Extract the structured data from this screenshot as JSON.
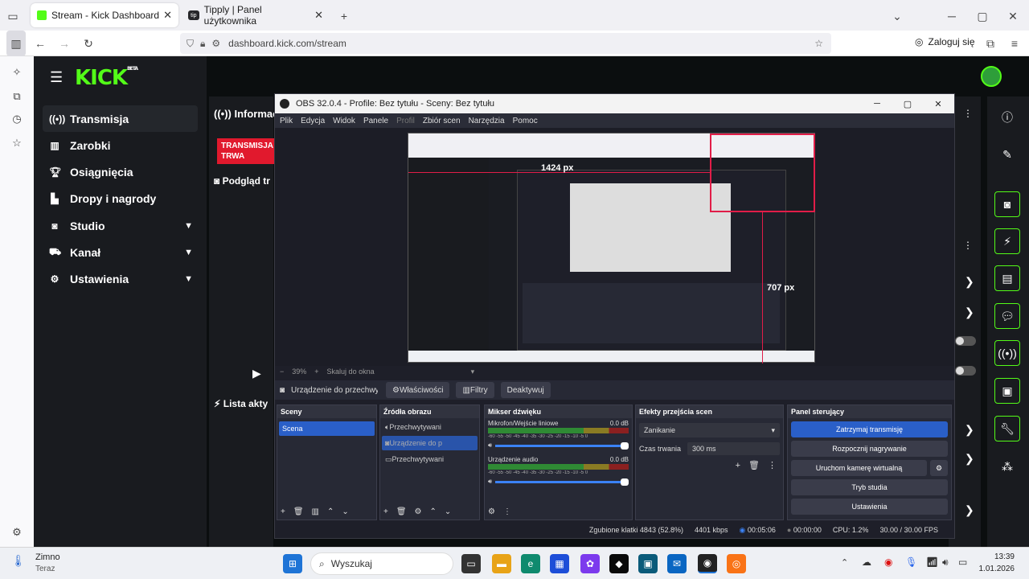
{
  "browser": {
    "tabs": [
      {
        "label": "Stream - Kick Dashboard"
      },
      {
        "label": "Tipply | Panel użytkownika"
      }
    ],
    "url": "dashboard.kick.com/stream",
    "login_label": "Zaloguj się"
  },
  "kick": {
    "logo": "KICK",
    "logo_badge": "BETA",
    "nav": [
      {
        "label": "Transmisja",
        "icon": "broadcast-icon"
      },
      {
        "label": "Zarobki",
        "icon": "chart-icon"
      },
      {
        "label": "Osiągnięcia",
        "icon": "trophy-icon"
      },
      {
        "label": "Dropy i nagrody",
        "icon": "gift-icon"
      },
      {
        "label": "Studio",
        "icon": "studio-icon"
      },
      {
        "label": "Kanał",
        "icon": "channel-icon"
      },
      {
        "label": "Ustawienia",
        "icon": "gear-icon"
      }
    ],
    "info_label": "Informacj",
    "live_badge": "TRANSMISJA TRWA",
    "preview_label": "Podgląd tr",
    "activity_label": "Lista akty"
  },
  "obs": {
    "title": "OBS 32.0.4 - Profile: Bez tytułu - Sceny: Bez tytułu",
    "menu": [
      "Plik",
      "Edycja",
      "Widok",
      "Panele",
      "Profil",
      "Zbiór scen",
      "Narzędzia",
      "Pomoc"
    ],
    "preview_width_label": "1424 px",
    "preview_height_label": "707 px",
    "zoom_label": "39%",
    "zoom_mode": "Skaluj do okna",
    "source_name": "Urządzenie do przechwyt",
    "properties_label": "Właściwości",
    "filters_label": "Filtry",
    "deactivate_label": "Deaktywuj",
    "scenes": {
      "title": "Sceny",
      "items": [
        "Scena"
      ]
    },
    "sources": {
      "title": "Źródła obrazu",
      "items": [
        "Przechwytywani",
        "Urządzenie do p",
        "Przechwytywani"
      ]
    },
    "mixer": {
      "title": "Mikser dźwięku",
      "channels": [
        {
          "name": "Mikrofon/Wejście liniowe",
          "db": "0.0 dB"
        },
        {
          "name": "Urządzenie audio",
          "db": "0.0 dB"
        }
      ],
      "scale": "-60 -55 -50 -45 -40 -35 -30 -25 -20 -15 -10 -5 0"
    },
    "transitions": {
      "title": "Efekty przejścia scen",
      "type": "Zanikanie",
      "duration_label": "Czas trwania",
      "duration": "300 ms"
    },
    "controls": {
      "title": "Panel sterujący",
      "buttons": [
        "Zatrzymaj transmisję",
        "Rozpocznij nagrywanie",
        "Uruchom kamerę wirtualną",
        "Tryb studia",
        "Ustawienia"
      ]
    },
    "status": {
      "dropped": "Zgubione klatki 4843 (52.8%)",
      "bitrate": "4401 kbps",
      "stream_time": "00:05:06",
      "rec_time": "00:00:00",
      "cpu": "CPU: 1.2%",
      "fps": "30.00 / 30.00 FPS"
    }
  },
  "taskbar": {
    "weather_title": "Zimno",
    "weather_sub": "Teraz",
    "search_placeholder": "Wyszukaj",
    "time": "13:39",
    "date": "1.01.2026"
  },
  "colors": {
    "kick_green": "#53fc18",
    "obs_blue": "#2a5fc8",
    "live_red": "#e1192d"
  }
}
